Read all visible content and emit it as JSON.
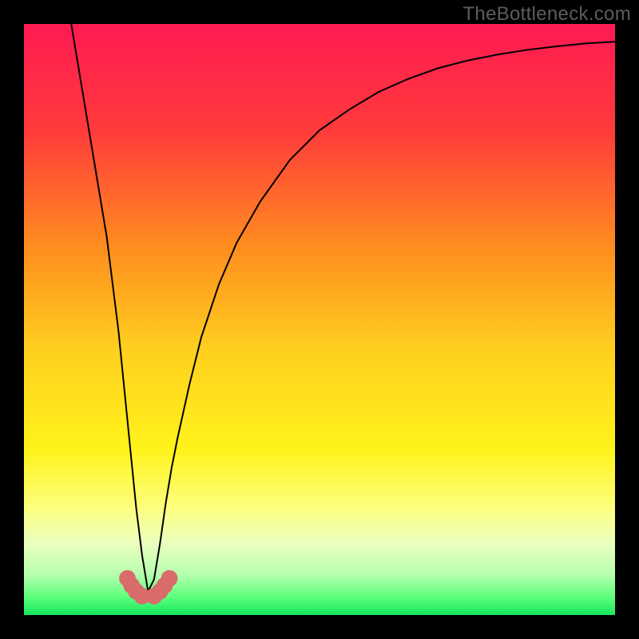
{
  "watermark": "TheBottleneck.com",
  "chart_data": {
    "type": "line",
    "title": "",
    "xlabel": "",
    "ylabel": "",
    "xlim": [
      0,
      100
    ],
    "ylim": [
      0,
      100
    ],
    "optimal_x": 21,
    "curve": {
      "x": [
        8,
        10,
        12,
        14,
        16,
        17,
        18,
        19,
        20,
        21,
        22,
        23,
        24,
        25,
        26,
        28,
        30,
        33,
        36,
        40,
        45,
        50,
        55,
        60,
        65,
        70,
        75,
        80,
        85,
        90,
        95,
        100
      ],
      "y": [
        100,
        88,
        76,
        64,
        48,
        38,
        28,
        18,
        10,
        4,
        6,
        12,
        19,
        25,
        30,
        39,
        47,
        56,
        63,
        70,
        77,
        82,
        85.5,
        88.5,
        90.7,
        92.5,
        93.8,
        94.8,
        95.6,
        96.2,
        96.7,
        97
      ]
    },
    "markers": {
      "x": [
        17.5,
        18.2,
        19.0,
        20.0,
        22.0,
        23.0,
        23.8,
        24.6
      ],
      "y": [
        6.2,
        5.0,
        4.0,
        3.2,
        3.2,
        4.0,
        5.0,
        6.2
      ]
    },
    "gradient_stops": [
      {
        "offset": 0,
        "color": "#ff1a53"
      },
      {
        "offset": 18,
        "color": "#ff3b3b"
      },
      {
        "offset": 38,
        "color": "#ff8e1f"
      },
      {
        "offset": 55,
        "color": "#ffcf1f"
      },
      {
        "offset": 72,
        "color": "#fff31a"
      },
      {
        "offset": 82,
        "color": "#fdff80"
      },
      {
        "offset": 88,
        "color": "#eaffc0"
      },
      {
        "offset": 93,
        "color": "#b8ffb0"
      },
      {
        "offset": 97,
        "color": "#5cff7a"
      },
      {
        "offset": 100,
        "color": "#17e65e"
      }
    ],
    "marker_color": "#d96b6b",
    "curve_color": "#000000"
  }
}
